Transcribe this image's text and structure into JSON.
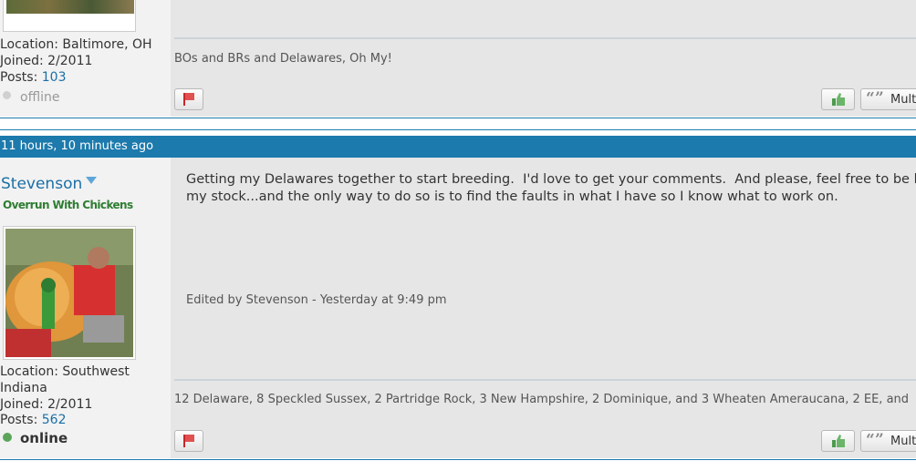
{
  "post1": {
    "location": "Location: Baltimore, OH",
    "joined": "Joined: 2/2011",
    "posts_label": "Posts: ",
    "posts_count": "103",
    "status": "offline",
    "signature": "BOs and BRs and Delawares, Oh My!",
    "multi_label": "Mult"
  },
  "post2": {
    "timestamp": "11 hours, 10 minutes ago",
    "username": "Stevenson",
    "user_title": "Overrun With Chickens",
    "body_line1": "Getting my Delawares together to start breeding.  I'd love to get your comments.  And please, feel free to be bru",
    "body_line2": "my stock...and the only way to do so is to find the faults in what I have so I know what to work on.",
    "edited": "Edited by Stevenson - Yesterday at 9:49 pm",
    "location_line1": "Location: Southwest",
    "location_line2": "Indiana",
    "joined": "Joined: 2/2011",
    "posts_label": "Posts: ",
    "posts_count": "562",
    "status": "online",
    "signature": "12 Delaware, 8 Speckled Sussex, 2 Partridge Rock, 3 New Hampshire, 2 Dominique, and 3 Wheaten Ameraucana, 2 EE, and",
    "multi_label": "Mult"
  },
  "colors": {
    "header_bar": "#1c7aac",
    "offline_dot": "#d0d0d0",
    "online_dot": "#5aa55a",
    "user_title": "#2e7d32"
  }
}
